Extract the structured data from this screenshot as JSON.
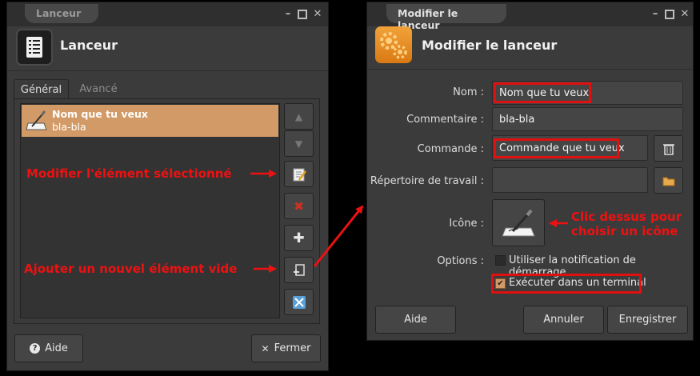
{
  "left_window": {
    "title": "Lanceur",
    "header_title": "Lanceur",
    "tabs": [
      {
        "label": "Général",
        "active": true
      },
      {
        "label": "Avancé",
        "active": false
      }
    ],
    "list_items": [
      {
        "title": "Nom que tu veux",
        "subtitle": "bla-bla",
        "selected": true
      }
    ],
    "side_buttons": [
      "arrow-up-icon",
      "arrow-down-icon",
      "edit-item-icon",
      "delete-item-icon",
      "add-item-icon",
      "add-empty-item-icon",
      "launcher-app-icon"
    ],
    "help_label": "Aide",
    "close_label": "Fermer"
  },
  "right_window": {
    "title": "Modifier le lanceur",
    "header_title": "Modifier le lanceur",
    "fields": {
      "name_label": "Nom :",
      "name_value": "Nom que tu veux",
      "comment_label": "Commentaire :",
      "comment_value": "bla-bla",
      "command_label": "Commande :",
      "command_value": "Commande que tu veux",
      "workdir_label": "Répertoire de travail :",
      "workdir_value": "",
      "icon_label": "Icône :",
      "options_label": "Options :"
    },
    "options": [
      {
        "label": "Utiliser la notification de démarrage",
        "checked": false
      },
      {
        "label": "Exécuter dans un terminal",
        "checked": true
      }
    ],
    "help_label": "Aide",
    "cancel_label": "Annuler",
    "save_label": "Enregistrer"
  },
  "annotations": {
    "modify": "Modifier l'élément sélectionné",
    "add": "Ajouter un nouvel élément vide",
    "icon_line1": "Clic dessus pour",
    "icon_line2": "choisir un icône"
  },
  "colors": {
    "selection": "#d29a66",
    "annotation": "#ee1111",
    "window_bg": "#3b3b3b"
  }
}
